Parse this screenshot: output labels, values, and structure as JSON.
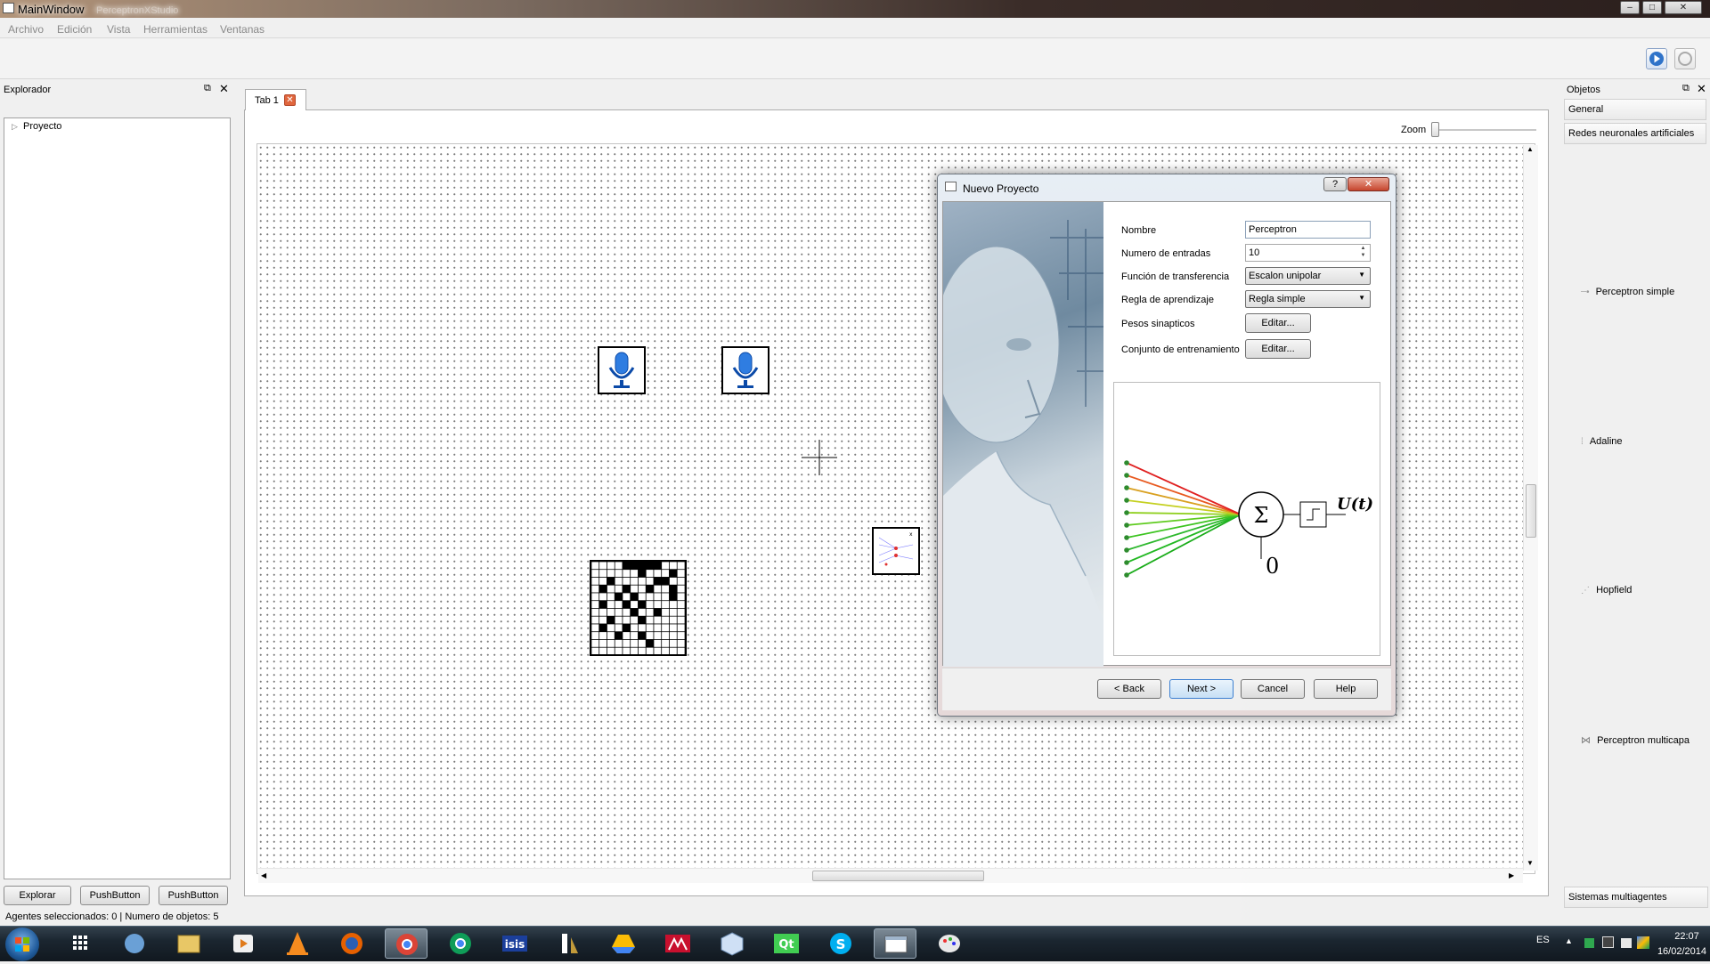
{
  "window": {
    "title": "MainWindow",
    "ghost_title": "PerceptronXStudio"
  },
  "menu": [
    "Archivo",
    "Edición",
    "Vista",
    "Herramientas",
    "Ventanas"
  ],
  "explorer": {
    "title": "Explorador",
    "tree_root": "Proyecto",
    "buttons": [
      "Explorar",
      "PushButton",
      "PushButton"
    ]
  },
  "tabs": [
    {
      "label": "Tab 1",
      "close_icon": "close-icon"
    }
  ],
  "zoom": {
    "label": "Zoom",
    "level": 0
  },
  "objects": {
    "title": "Objetos",
    "categories": [
      "General",
      "Redes neuronales artificiales"
    ],
    "items": [
      "Perceptron simple",
      "Adaline",
      "Hopfield",
      "Perceptron multicapa"
    ],
    "footer_category": "Sistemas multiagentes"
  },
  "dialog": {
    "title": "Nuevo Proyecto",
    "help_glyph": "?",
    "fields": {
      "nombre_label": "Nombre",
      "nombre_value": "Perceptron",
      "entradas_label": "Numero de entradas",
      "entradas_value": "10",
      "funcion_label": "Función de transferencia",
      "funcion_value": "Escalon unipolar",
      "regla_label": "Regla de aprendizaje",
      "regla_value": "Regla simple",
      "pesos_label": "Pesos sinapticos",
      "pesos_button": "Editar...",
      "conjunto_label": "Conjunto de entrenamiento",
      "conjunto_button": "Editar..."
    },
    "diagram": {
      "sum_symbol": "Σ",
      "output_label": "U(t)",
      "bias_label": "0"
    },
    "buttons": {
      "back": "< Back",
      "next": "Next >",
      "cancel": "Cancel",
      "help": "Help"
    }
  },
  "status": "Agentes seleccionados: 0 | Numero de objetos: 5",
  "taskbar": {
    "lang": "ES",
    "time": "22:07",
    "date": "16/02/2014"
  },
  "colors": {
    "accent": "#3c7fd1",
    "neuron_red": "#e02020",
    "neuron_green": "#22b822",
    "node_green": "#2e8b2e"
  }
}
